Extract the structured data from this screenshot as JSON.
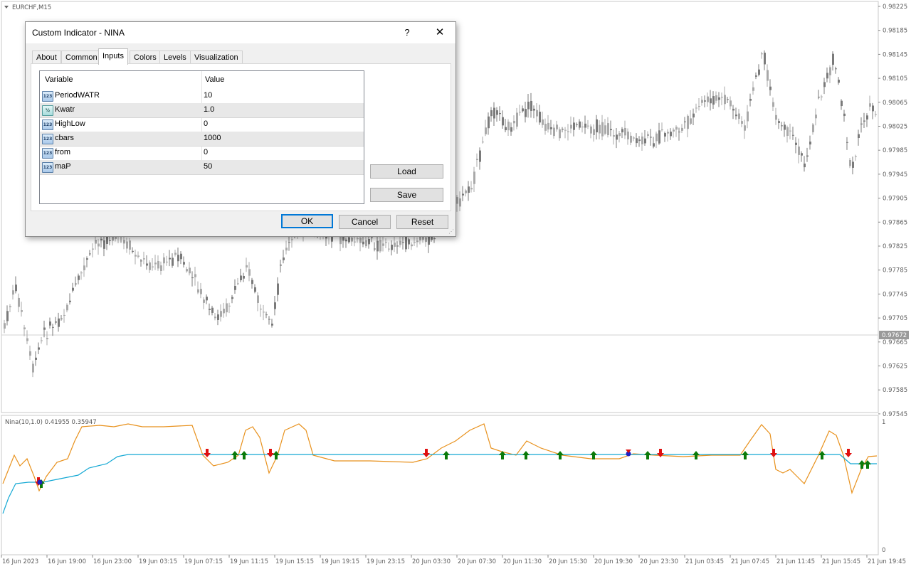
{
  "chart": {
    "symbol_label": "EURCHF,M15",
    "price_ticks": [
      "0.98225",
      "0.98185",
      "0.98145",
      "0.98105",
      "0.98065",
      "0.98025",
      "0.97985",
      "0.97945",
      "0.97905",
      "0.97865",
      "0.97825",
      "0.97785",
      "0.97745",
      "0.97705",
      "0.97665",
      "0.97625",
      "0.97585",
      "0.97545"
    ],
    "current_price": "0.97672",
    "time_ticks": [
      "16 Jun 2023",
      "16 Jun 19:00",
      "16 Jun 23:00",
      "19 Jun 03:15",
      "19 Jun 07:15",
      "19 Jun 11:15",
      "19 Jun 15:15",
      "19 Jun 19:15",
      "19 Jun 23:15",
      "20 Jun 03:30",
      "20 Jun 07:30",
      "20 Jun 11:30",
      "20 Jun 15:30",
      "20 Jun 19:30",
      "20 Jun 23:30",
      "21 Jun 03:45",
      "21 Jun 07:45",
      "21 Jun 11:45",
      "21 Jun 15:45",
      "21 Jun 19:45"
    ],
    "indicator_label": "Nina(10,1.0) 0.41955 0.35947",
    "indicator_scale_top": "1",
    "indicator_scale_bottom": "0",
    "colors": {
      "candle": "#a9a9a9",
      "candle_dark": "#7a7a7a",
      "orange_line": "#e8911c",
      "blue_line": "#13a8d4",
      "up_arrow": "#0a7a0a",
      "down_arrow": "#e01010",
      "cross_dot": "#2020c0"
    }
  },
  "dialog": {
    "title": "Custom Indicator - NINA",
    "help_glyph": "?",
    "close_glyph": "✕",
    "tabs": [
      {
        "label": "About"
      },
      {
        "label": "Common"
      },
      {
        "label": "Inputs",
        "active": true
      },
      {
        "label": "Colors"
      },
      {
        "label": "Levels"
      },
      {
        "label": "Visualization"
      }
    ],
    "grid": {
      "col_variable": "Variable",
      "col_value": "Value",
      "rows": [
        {
          "icon": "123",
          "variable": "PeriodWATR",
          "value": "10"
        },
        {
          "icon": "½",
          "variable": "Kwatr",
          "value": "1.0"
        },
        {
          "icon": "123",
          "variable": "HighLow",
          "value": "0"
        },
        {
          "icon": "123",
          "variable": "cbars",
          "value": "1000"
        },
        {
          "icon": "123",
          "variable": "from",
          "value": "0"
        },
        {
          "icon": "123",
          "variable": "maP",
          "value": "50"
        }
      ]
    },
    "load_label": "Load",
    "save_label": "Save",
    "ok_label": "OK",
    "cancel_label": "Cancel",
    "reset_label": "Reset"
  }
}
